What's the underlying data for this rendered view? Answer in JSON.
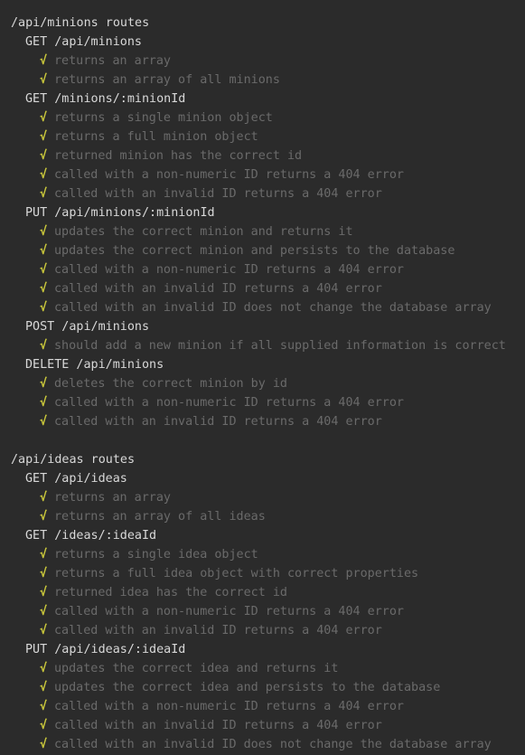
{
  "theme": {
    "background": "#2b2b2b",
    "heading": "#d8d8d8",
    "pass_check": "#c6c43b",
    "test_text": "#6a6a6a"
  },
  "check_glyph": "√",
  "suites": [
    {
      "title": "/api/minions routes",
      "groups": [
        {
          "title": "GET /api/minions",
          "tests": [
            "returns an array",
            "returns an array of all minions"
          ]
        },
        {
          "title": "GET /minions/:minionId",
          "tests": [
            "returns a single minion object",
            "returns a full minion object",
            "returned minion has the correct id",
            "called with a non-numeric ID returns a 404 error",
            "called with an invalid ID returns a 404 error"
          ]
        },
        {
          "title": "PUT /api/minions/:minionId",
          "tests": [
            "updates the correct minion and returns it",
            "updates the correct minion and persists to the database",
            "called with a non-numeric ID returns a 404 error",
            "called with an invalid ID returns a 404 error",
            "called with an invalid ID does not change the database array"
          ]
        },
        {
          "title": "POST /api/minions",
          "tests": [
            "should add a new minion if all supplied information is correct"
          ]
        },
        {
          "title": "DELETE /api/minions",
          "tests": [
            "deletes the correct minion by id",
            "called with a non-numeric ID returns a 404 error",
            "called with an invalid ID returns a 404 error"
          ]
        }
      ]
    },
    {
      "title": "/api/ideas routes",
      "groups": [
        {
          "title": "GET /api/ideas",
          "tests": [
            "returns an array",
            "returns an array of all ideas"
          ]
        },
        {
          "title": "GET /ideas/:ideaId",
          "tests": [
            "returns a single idea object",
            "returns a full idea object with correct properties",
            "returned idea has the correct id",
            "called with a non-numeric ID returns a 404 error",
            "called with an invalid ID returns a 404 error"
          ]
        },
        {
          "title": "PUT /api/ideas/:ideaId",
          "tests": [
            "updates the correct idea and returns it",
            "updates the correct idea and persists to the database",
            "called with a non-numeric ID returns a 404 error",
            "called with an invalid ID returns a 404 error",
            "called with an invalid ID does not change the database array"
          ]
        }
      ]
    }
  ]
}
